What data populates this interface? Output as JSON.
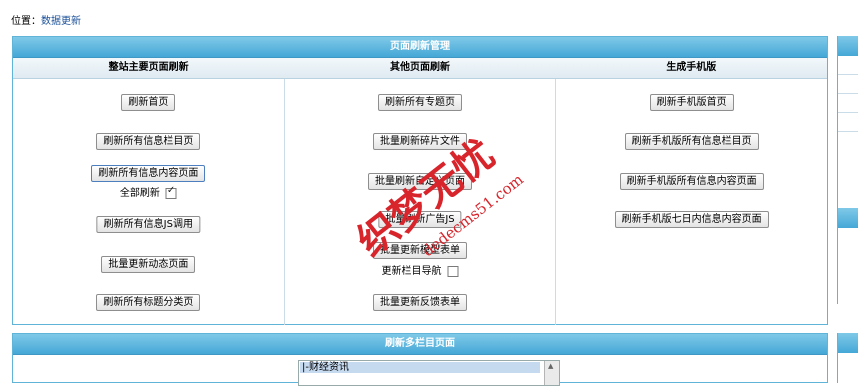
{
  "breadcrumb": {
    "label": "位置：",
    "current": "数据更新"
  },
  "main_panel": {
    "title": "页面刷新管理",
    "columns": [
      {
        "heading": "整站主要页面刷新",
        "buttons": [
          "刷新首页",
          "刷新所有信息栏目页",
          "刷新所有信息内容页面",
          "刷新所有信息JS调用",
          "批量更新动态页面",
          "刷新所有标题分类页"
        ],
        "checkbox": {
          "label": "全部刷新",
          "checked": true
        }
      },
      {
        "heading": "其他页面刷新",
        "buttons": [
          "刷新所有专题页",
          "批量刷新碎片文件",
          "批量刷新自定义页面",
          "批量刷新广告JS",
          "批量更新模型表单",
          "批量更新反馈表单"
        ],
        "checkbox": {
          "label": "更新栏目导航",
          "checked": false
        }
      },
      {
        "heading": "生成手机版",
        "buttons": [
          "刷新手机版首页",
          "刷新手机版所有信息栏目页",
          "刷新手机版所有信息内容页面",
          "刷新手机版七日内信息内容页面"
        ]
      }
    ]
  },
  "bottom_panel": {
    "title": "刷新多栏目页面",
    "select_option": "|-财经资讯"
  },
  "watermark": {
    "text": "织梦无忧",
    "url": "dedecms51.com",
    "color": "#d8242b"
  }
}
